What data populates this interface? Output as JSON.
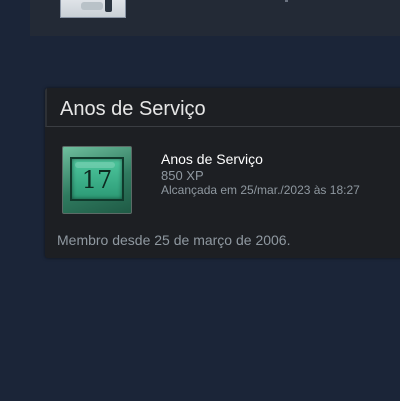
{
  "service_card": {
    "title": "Anos de Serviço",
    "badge": {
      "number": "17",
      "icon": "years-of-service-badge",
      "color": "#3fae86"
    },
    "achievement": {
      "name": "Anos de Serviço",
      "xp": "850 XP",
      "unlocked": "Alcançada em 25/mar./2023 às 18:27"
    },
    "member_since": "Membro desde 25 de março de 2006."
  },
  "colors": {
    "background": "#1b2538",
    "card": "#1d1f23",
    "muted_text": "#8f98a0"
  }
}
